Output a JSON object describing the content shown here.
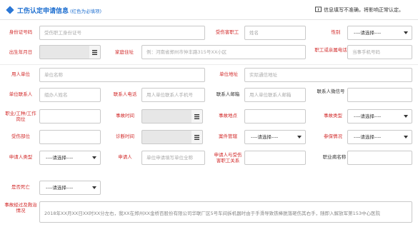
{
  "header": {
    "title": "工伤认定申请信息",
    "subtitle": "(红色为必填项)",
    "note": "信息填写不准确，将影响正常认定。"
  },
  "form": {
    "worker_id": {
      "label": "身份证号码",
      "placeholder": "受伤职工身份证号"
    },
    "worker_name": {
      "label": "受伤害职工",
      "placeholder": "姓名"
    },
    "gender": {
      "label": "性别",
      "value": "----请选择----"
    },
    "birth_date": {
      "label": "出生年月日"
    },
    "home_address": {
      "label": "家庭住址",
      "placeholder": "例：河南省郑州市仲丰路315号XX小区"
    },
    "worker_phone": {
      "label": "职工或亲属电话",
      "placeholder": "当事手机号码"
    },
    "employer": {
      "label": "用人单位",
      "placeholder": "单位名称"
    },
    "employer_address": {
      "label": "单位地址",
      "placeholder": "实际通信地址"
    },
    "employer_contact": {
      "label": "单位联系人",
      "placeholder": "组办人姓名"
    },
    "contact_phone": {
      "label": "联系人电话",
      "placeholder": "用人单位联系人手机号"
    },
    "contact_email": {
      "label": "联系人邮箱",
      "placeholder": "用人单位联系人邮箱"
    },
    "contact_wechat": {
      "label": "联系人微信号"
    },
    "job_type": {
      "label": "职业/工种/工作岗位"
    },
    "accident_time": {
      "label": "事故时间"
    },
    "accident_location": {
      "label": "事故地点"
    },
    "accident_type": {
      "label": "事故类型",
      "value": "----请选择----"
    },
    "injury_location": {
      "label": "受伤部位"
    },
    "diagnosis_time": {
      "label": "诊断时间"
    },
    "accident_handling": {
      "label": "案件管辖",
      "value": "----请选择----"
    },
    "insurance_status": {
      "label": "参保情况",
      "value": "----请选择----"
    },
    "applicant_type": {
      "label": "申请人类型",
      "value": "----请选择----"
    },
    "applicant": {
      "label": "申请人",
      "placeholder": "单位申请填写单位全称"
    },
    "applicant_relation": {
      "label": "申请人与受伤害职工关系"
    },
    "occupational_disease": {
      "label": "职业病名称"
    },
    "is_deceased": {
      "label": "是否死亡",
      "value": "----请选择----"
    },
    "accident_description": {
      "label": "事故经过及救治情况",
      "value": "2018年XX月XX日XX时XX分左右，我XX在郑州XX金桥百股份有限公司华联厂区5号车间拆机器时由于手滑导致铁棒脱落砸伤其右手，随即入解放军第153中心医院"
    }
  }
}
